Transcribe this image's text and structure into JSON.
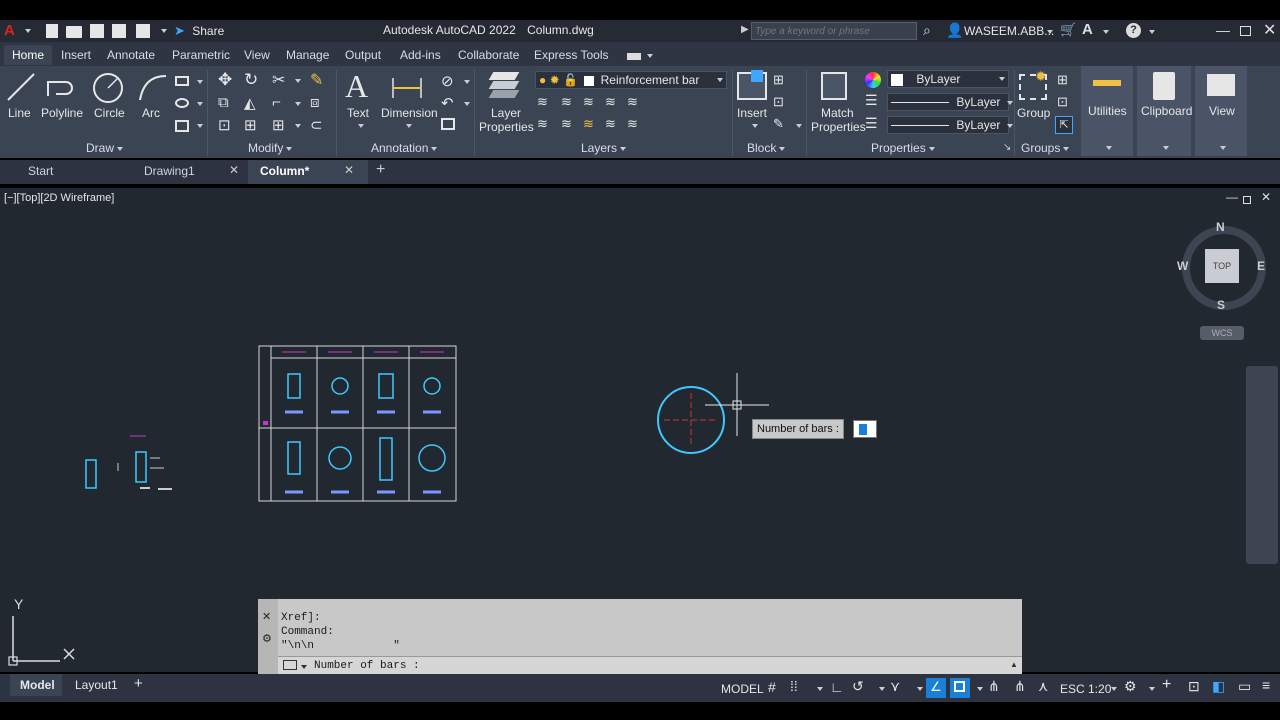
{
  "app": {
    "title": "Autodesk AutoCAD 2022",
    "filename": "Column.dwg",
    "share_label": "Share",
    "search_placeholder": "Type a keyword or phrase",
    "user": "WASEEM.ABB..."
  },
  "ribbon_tabs": [
    "Home",
    "Insert",
    "Annotate",
    "Parametric",
    "View",
    "Manage",
    "Output",
    "Add-ins",
    "Collaborate",
    "Express Tools"
  ],
  "draw": {
    "line": "Line",
    "polyline": "Polyline",
    "circle": "Circle",
    "arc": "Arc",
    "panel": "Draw"
  },
  "modify": {
    "panel": "Modify"
  },
  "annotation": {
    "text": "Text",
    "dimension": "Dimension",
    "panel": "Annotation"
  },
  "layers": {
    "layer_properties_1": "Layer",
    "layer_properties_2": "Properties",
    "current_layer": "Reinforcement bar",
    "panel": "Layers"
  },
  "block": {
    "insert": "Insert",
    "panel": "Block"
  },
  "properties": {
    "match_1": "Match",
    "match_2": "Properties",
    "color": "ByLayer",
    "linetype": "ByLayer",
    "lineweight": "ByLayer",
    "panel": "Properties"
  },
  "groups": {
    "group": "Group",
    "panel": "Groups"
  },
  "utilities": "Utilities",
  "clipboard": "Clipboard",
  "view": "View",
  "doc_tabs": {
    "start": "Start",
    "drawing1": "Drawing1",
    "column": "Column*"
  },
  "viewport_label": "[−][Top][2D Wireframe]",
  "viewcube": {
    "n": "N",
    "s": "S",
    "e": "E",
    "w": "W",
    "top": "TOP",
    "wcs": "WCS"
  },
  "ucs": {
    "y": "Y"
  },
  "tooltip": {
    "prompt": "Number of bars :"
  },
  "command": {
    "history_1": "Xref]:",
    "history_2": "Command:",
    "history_3": "\"\\n\\n            \"",
    "prompt": "Number of bars :"
  },
  "layout_tabs": {
    "model": "Model",
    "layout1": "Layout1"
  },
  "status": {
    "model": "MODEL",
    "scale": "ESC 1:20"
  }
}
